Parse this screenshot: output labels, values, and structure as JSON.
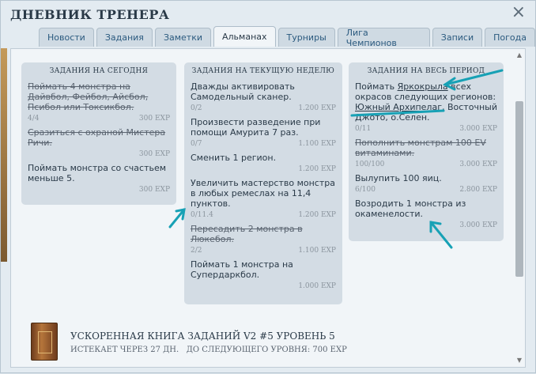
{
  "window": {
    "title": "ДНЕВНИК ТРЕНЕРА",
    "close_icon": "×"
  },
  "tabs": [
    {
      "label": "Новости",
      "active": false
    },
    {
      "label": "Задания",
      "active": false
    },
    {
      "label": "Заметки",
      "active": false
    },
    {
      "label": "Альманах",
      "active": true
    },
    {
      "label": "Турниры",
      "active": false
    },
    {
      "label": "Лига Чемпионов",
      "active": false
    },
    {
      "label": "Записи",
      "active": false
    },
    {
      "label": "Погода",
      "active": false
    }
  ],
  "columns": {
    "today": {
      "title": "ЗАДАНИЯ НА СЕГОДНЯ",
      "tasks": [
        {
          "text": "Поймать 4 монстра на Дайвбол, Фейбол, Айсбол, Псибол или Токсикбол.",
          "done": true,
          "progress": "4/4",
          "reward": "300 EXP"
        },
        {
          "text": "Сразиться с охраной Мистера Ричи.",
          "done": true,
          "progress": "",
          "reward": "300 EXP"
        },
        {
          "text": "Поймать монстра со счастьем меньше 5.",
          "done": false,
          "progress": "",
          "reward": "300 EXP"
        }
      ]
    },
    "week": {
      "title": "ЗАДАНИЯ НА ТЕКУЩУЮ НЕДЕЛЮ",
      "tasks": [
        {
          "text": "Дважды активировать Самодельный сканер.",
          "done": false,
          "progress": "0/2",
          "reward": "1.200 EXP"
        },
        {
          "text": "Произвести разведение при помощи Амурита 7 раз.",
          "done": false,
          "progress": "0/7",
          "reward": "1.100 EXP"
        },
        {
          "text": "Сменить 1 регион.",
          "done": false,
          "progress": "",
          "reward": "1.200 EXP"
        },
        {
          "text": "Увеличить мастерство монстра в любых ремеслах на 11,4 пунктов.",
          "done": false,
          "progress": "0/11.4",
          "reward": "1.200 EXP"
        },
        {
          "text": "Пересадить 2 монстра в Люкебол.",
          "done": true,
          "progress": "2/2",
          "reward": "1.100 EXP"
        },
        {
          "text": "Поймать 1 монстра на Супердаркбол.",
          "done": false,
          "progress": "",
          "reward": "1.000 EXP"
        }
      ]
    },
    "period": {
      "title": "ЗАДАНИЯ НА ВЕСЬ ПЕРИОД",
      "tasks": [
        {
          "text_parts": [
            "Поймать ",
            "Яркокрыла",
            " всех окрасов следующих регионов: ",
            "Южный Архипелаг",
            ", Восточный Джото, о.Селен."
          ],
          "done": false,
          "progress": "0/11",
          "reward": "3.000 EXP"
        },
        {
          "text": "Пополнить монстрам 100 EV витаминами.",
          "done": true,
          "progress": "100/100",
          "reward": "3.000 EXP"
        },
        {
          "text": "Вылупить 100 яиц.",
          "done": false,
          "progress": "6/100",
          "reward": "2.800 EXP"
        },
        {
          "text": "Возродить 1 монстра из окаменелости.",
          "done": false,
          "progress": "",
          "reward": "3.000 EXP"
        }
      ]
    }
  },
  "battle_pass": {
    "title": "УСКОРЕННАЯ КНИГА ЗАДАНИЙ V2 #5 УРОВЕНЬ 5",
    "expires": "ИСТЕКАЕТ ЧЕРЕЗ 27 ДН.",
    "next_level": "ДО СЛЕДУЮЩЕГО УРОВНЯ: 700 EXP"
  },
  "annotation_color": "#17a1b5"
}
